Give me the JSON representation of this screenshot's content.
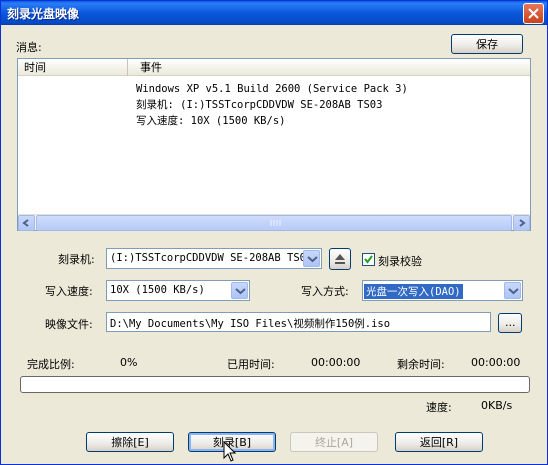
{
  "window": {
    "title": "刻录光盘映像"
  },
  "messages": {
    "label": "消息:",
    "save_button": "保存",
    "columns": [
      "时间",
      "事件"
    ],
    "rows": [
      "Windows XP v5.1 Build 2600 (Service Pack 3)",
      "刻录机: (I:)TSSTcorpCDDVDW SE-208AB TS03",
      "写入速度: 10X (1500 KB/s)"
    ]
  },
  "burner": {
    "label": "刻录机:",
    "value": "(I:)TSSTcorpCDDVDW SE-208AB TS03",
    "verify_label": "刻录校验",
    "verify_checked": true
  },
  "write_speed": {
    "label": "写入速度:",
    "value": "10X (1500 KB/s)"
  },
  "write_mode": {
    "label": "写入方式:",
    "value": "光盘一次写入(DAO)"
  },
  "image_file": {
    "label": "映像文件:",
    "value": "D:\\My Documents\\My ISO Files\\视频制作150例.iso",
    "browse_label": "..."
  },
  "status": {
    "complete_label": "完成比例:",
    "complete_value": "0%",
    "progress_fraction": 0,
    "elapsed_label": "已用时间:",
    "elapsed_value": "00:00:00",
    "remaining_label": "剩余时间:",
    "remaining_value": "00:00:00",
    "speed_label": "速度:",
    "speed_value": "0KB/s"
  },
  "buttons": {
    "erase": "擦除[E]",
    "burn": "刻录[B]",
    "abort": "终止[A]",
    "back": "返回[R]"
  },
  "colors": {
    "titlebar": "#0a58dc",
    "window_bg": "#ece9d8",
    "progress_fill": "#2fc02f"
  }
}
